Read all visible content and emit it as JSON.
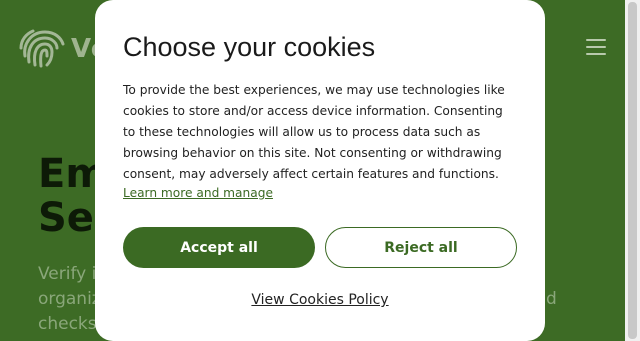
{
  "header": {
    "logo_text": "Ve",
    "logo_icon": "fingerprint-icon",
    "menu_icon": "hamburger-menu-icon"
  },
  "hero": {
    "title_line1": "Em",
    "title_line2": "Sea",
    "text_line1": "Verify i",
    "text_line2": "organiz",
    "text_line2_end": "d",
    "text_line3": "checks"
  },
  "cookie_modal": {
    "title": "Choose your cookies",
    "body": "To provide the best experiences, we may use technologies like cookies to store and/or access device information. Consenting to these technologies will allow us to process data such as browsing behavior on this site. Not consenting or withdrawing consent, may adversely affect certain features and functions.",
    "learn_more": "Learn more and manage",
    "accept_label": "Accept all",
    "reject_label": "Reject all",
    "policy_link": "View Cookies Policy"
  },
  "colors": {
    "brand_green": "#3b6a23",
    "background_green": "#3d6b25"
  }
}
